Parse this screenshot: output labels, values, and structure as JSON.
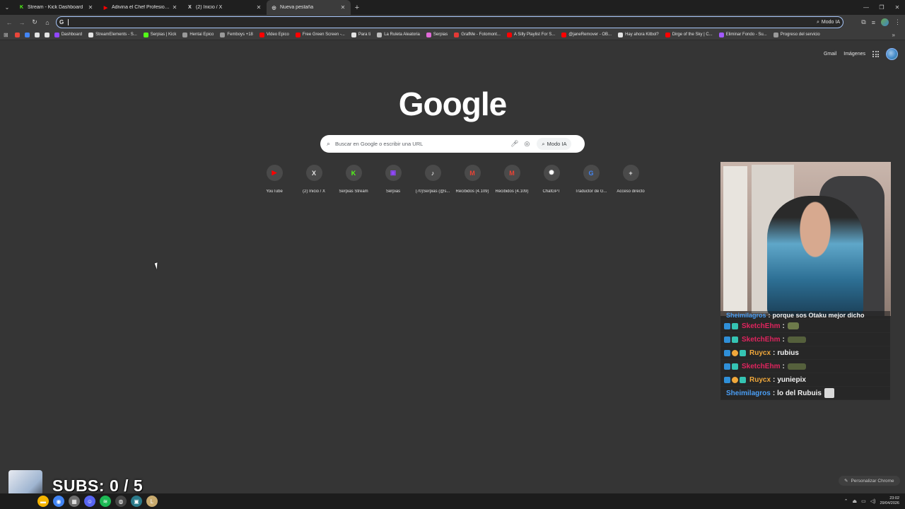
{
  "tabs": [
    {
      "title": "Stream - Kick Dashboard",
      "icon": "K",
      "color": "#53fc18"
    },
    {
      "title": "Adivina el Chef Profesional - Yo",
      "icon": "▶",
      "color": "#ff0000"
    },
    {
      "title": "(2) Inicio / X",
      "icon": "X",
      "color": "#e3e3e3"
    },
    {
      "title": "Nueva pestaña",
      "icon": "◎",
      "color": "#e3e3e3"
    }
  ],
  "omnibox": {
    "ai_label": "Modo IA"
  },
  "bookmarks": [
    {
      "label": "",
      "color": "#e9463a"
    },
    {
      "label": "",
      "color": "#4285f4"
    },
    {
      "label": "",
      "color": "#e3e3e3"
    },
    {
      "label": "",
      "color": "#e3e3e3"
    },
    {
      "label": "Dashboard",
      "color": "#9146ff"
    },
    {
      "label": "StreamElements - S...",
      "color": "#e3e3e3"
    },
    {
      "label": "Serpias | Kick",
      "color": "#53fc18"
    },
    {
      "label": "Hentai Epico",
      "color": "#9a9a9a"
    },
    {
      "label": "Femboys +18",
      "color": "#9a9a9a"
    },
    {
      "label": "Video Epico",
      "color": "#ff0000"
    },
    {
      "label": "Free Green Screen -...",
      "color": "#ff0000"
    },
    {
      "label": "Para ti",
      "color": "#e3e3e3"
    },
    {
      "label": "La Ruleta Aleatoria",
      "color": "#bdbdbd"
    },
    {
      "label": "Serpias",
      "color": "#e06ad8"
    },
    {
      "label": "GrafMe - Fotomont...",
      "color": "#e53935"
    },
    {
      "label": "A Silly Playlist For S...",
      "color": "#ff0000"
    },
    {
      "label": "@janeRemover - OB...",
      "color": "#ff0000"
    },
    {
      "label": "Hay ahora Kitbol?",
      "color": "#e3e3e3"
    },
    {
      "label": "Dirge of the Sky | C...",
      "color": "#ff0000"
    },
    {
      "label": "Eliminar Fondo - Su...",
      "color": "#a259ff"
    },
    {
      "label": "Progreso del servicio",
      "color": "#9a9a9a"
    }
  ],
  "top_links": {
    "gmail": "Gmail",
    "images": "Imágenes"
  },
  "logo": "Google",
  "search": {
    "placeholder": "Buscar en Google o escribir una URL",
    "mode_label": "Modo IA"
  },
  "shortcuts": [
    {
      "label": "YouTube",
      "icon": "▶",
      "color": "#ff0000"
    },
    {
      "label": "(2) Inicio / X",
      "icon": "X",
      "color": "#e3e3e3"
    },
    {
      "label": "Serpias Stream",
      "icon": "K",
      "color": "#53fc18"
    },
    {
      "label": "Serpias",
      "icon": "▣",
      "color": "#9146ff"
    },
    {
      "label": "(70)Serpias (@s...",
      "icon": "♪",
      "color": "#ffffff"
    },
    {
      "label": "Recibidos (4.109)",
      "icon": "M",
      "color": "#ea4335"
    },
    {
      "label": "Recibidos (4.109)",
      "icon": "M",
      "color": "#ea4335"
    },
    {
      "label": "ChatGPT",
      "icon": "✺",
      "color": "#ffffff"
    },
    {
      "label": "Traductor de G...",
      "icon": "G",
      "color": "#4285f4"
    },
    {
      "label": "Acceso directo",
      "icon": "+",
      "color": "#e3e3e3"
    }
  ],
  "chat": [
    {
      "user": "Sheimilagros",
      "color": "#4a9ef5",
      "msg": "porque sos Otaku mejor dicho",
      "badges": [],
      "emote": ""
    },
    {
      "user": "SketchEhm",
      "color": "#e0245e",
      "msg": "",
      "badges": [
        "blue",
        "teal"
      ],
      "emote": "small"
    },
    {
      "user": "SketchEhm",
      "color": "#e0245e",
      "msg": "",
      "badges": [
        "blue",
        "teal"
      ],
      "emote": "big"
    },
    {
      "user": "Ruycx",
      "color": "#f1a83b",
      "msg": "rubius",
      "badges": [
        "blue",
        "gold",
        "teal"
      ],
      "emote": ""
    },
    {
      "user": "SketchEhm",
      "color": "#e0245e",
      "msg": "",
      "badges": [
        "blue",
        "teal"
      ],
      "emote": "big"
    },
    {
      "user": "Ruycx",
      "color": "#f1a83b",
      "msg": "yuniepix",
      "badges": [
        "blue",
        "gold",
        "teal"
      ],
      "emote": ""
    },
    {
      "user": "Sheimilagros",
      "color": "#4a9ef5",
      "msg": "lo del Rubuis",
      "badges": [],
      "emote": "face"
    }
  ],
  "subs": "SUBS: 0 / 5",
  "customize_label": "Personalizar Chrome",
  "taskbar": {
    "apps": [
      {
        "name": "files-icon",
        "color": "#f4b400",
        "glyph": "▬"
      },
      {
        "name": "chrome-icon",
        "color": "#4285f4",
        "glyph": "◉"
      },
      {
        "name": "app-icon",
        "color": "#6e6e6e",
        "glyph": "▦"
      },
      {
        "name": "discord-icon",
        "color": "#5865f2",
        "glyph": "☺"
      },
      {
        "name": "spotify-icon",
        "color": "#1db954",
        "glyph": "≋"
      },
      {
        "name": "obs-icon",
        "color": "#444444",
        "glyph": "◍"
      },
      {
        "name": "store-icon",
        "color": "#2b7a8a",
        "glyph": "▣"
      },
      {
        "name": "league-icon",
        "color": "#c8aa6e",
        "glyph": "L"
      }
    ],
    "time": "23:02",
    "date": "29/04/2026"
  }
}
